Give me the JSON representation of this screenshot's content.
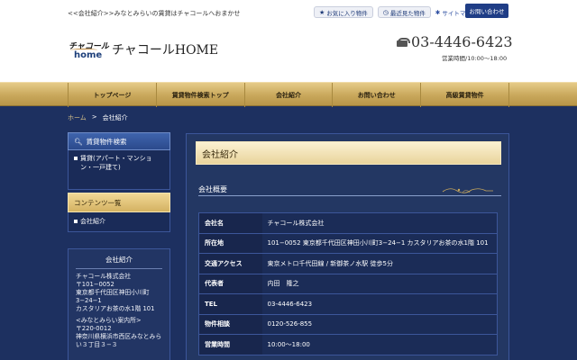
{
  "header": {
    "tagline": "<<会社紹介>>みなとみらいの賃貸はチャコールへおまかせ",
    "favorites_label": "お気に入り物件",
    "recent_label": "最近見た物件",
    "sitemap_label": "サイトマップ",
    "contact_label": "お問い合わせ",
    "logo_script": "チャコール",
    "logo_home": "home",
    "site_name": "チャコールHOME",
    "phone": "03-4446-6423",
    "hours": "営業時間/10:00〜18:00"
  },
  "nav": {
    "items": [
      "トップページ",
      "賃貸物件検索トップ",
      "会社紹介",
      "お問い合わせ",
      "高級賃貸物件"
    ]
  },
  "breadcrumb": {
    "home": "ホーム",
    "sep": ">",
    "current": "会社紹介"
  },
  "sidebar": {
    "search_title": "賃貸物件検索",
    "search_items": [
      "賃貸(アパート・マンション・一戸建て)"
    ],
    "contents_title": "コンテンツ一覧",
    "contents_items": [
      "会社紹介"
    ],
    "company_title": "会社紹介",
    "company_name": "チャコール株式会社",
    "company_zip": "〒101−0052",
    "company_addr": "東京都千代田区神田小川町3−24−1",
    "company_bldg": "カスタリアお茶の水1階 101",
    "branch_name": "<みなとみらい案内所>",
    "branch_zip": "〒220-0012",
    "branch_addr": "神奈川県横浜市西区みなとみらい３丁目３−３"
  },
  "main": {
    "title": "会社紹介",
    "section": "会社概要",
    "rows": [
      {
        "key": "会社名",
        "value": "チャコール株式会社"
      },
      {
        "key": "所在地",
        "value": "101−0052 東京都千代田区神田小川町3−24−1 カスタリアお茶の水1階 101"
      },
      {
        "key": "交通アクセス",
        "value": "東京メトロ千代田線 / 新御茶ノ水駅 徒歩5分"
      },
      {
        "key": "代表者",
        "value": "内田　隆之"
      },
      {
        "key": "TEL",
        "value": "03-4446-6423"
      },
      {
        "key": "物件相談",
        "value": "0120-526-855"
      },
      {
        "key": "営業時間",
        "value": "10:00〜18:00"
      }
    ]
  }
}
